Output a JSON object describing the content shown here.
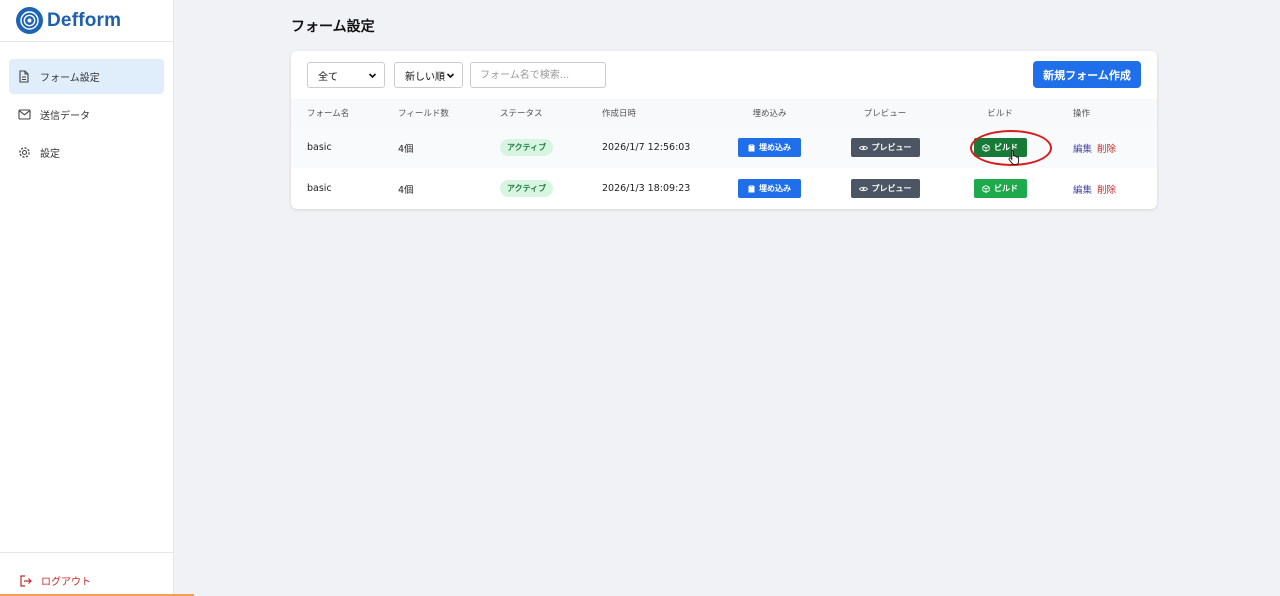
{
  "app": {
    "name": "Defform"
  },
  "sidebar": {
    "items": [
      {
        "label": "フォーム設定",
        "icon": "document-icon",
        "active": true
      },
      {
        "label": "送信データ",
        "icon": "mail-icon",
        "active": false
      },
      {
        "label": "設定",
        "icon": "gear-icon",
        "active": false
      }
    ],
    "logout_label": "ログアウト"
  },
  "page": {
    "title": "フォーム設定"
  },
  "toolbar": {
    "status_filter": "全て",
    "sort_order": "新しい順",
    "search_placeholder": "フォーム名で検索...",
    "search_value": "",
    "new_button_label": "新規フォーム作成"
  },
  "table": {
    "columns": [
      "フォーム名",
      "フィールド数",
      "ステータス",
      "作成日時",
      "埋め込み",
      "プレビュー",
      "ビルド",
      "操作"
    ],
    "rows": [
      {
        "name": "basic",
        "fields": "4個",
        "status": "アクティブ",
        "created": "2026/1/7 12:56:03",
        "embed": "埋め込み",
        "preview": "プレビュー",
        "build": "ビルド",
        "edit": "編集",
        "delete": "削除"
      },
      {
        "name": "basic",
        "fields": "4個",
        "status": "アクティブ",
        "created": "2026/1/3 18:09:23",
        "embed": "埋め込み",
        "preview": "プレビュー",
        "build": "ビルド",
        "edit": "編集",
        "delete": "削除"
      }
    ]
  },
  "colors": {
    "primary": "#1f6feb",
    "build": "#1fa94d",
    "build_hover": "#177a37",
    "preview": "#4b5563",
    "danger": "#c62828",
    "active_badge_bg": "#d8f5e1",
    "annotation": "#d81b1b"
  }
}
